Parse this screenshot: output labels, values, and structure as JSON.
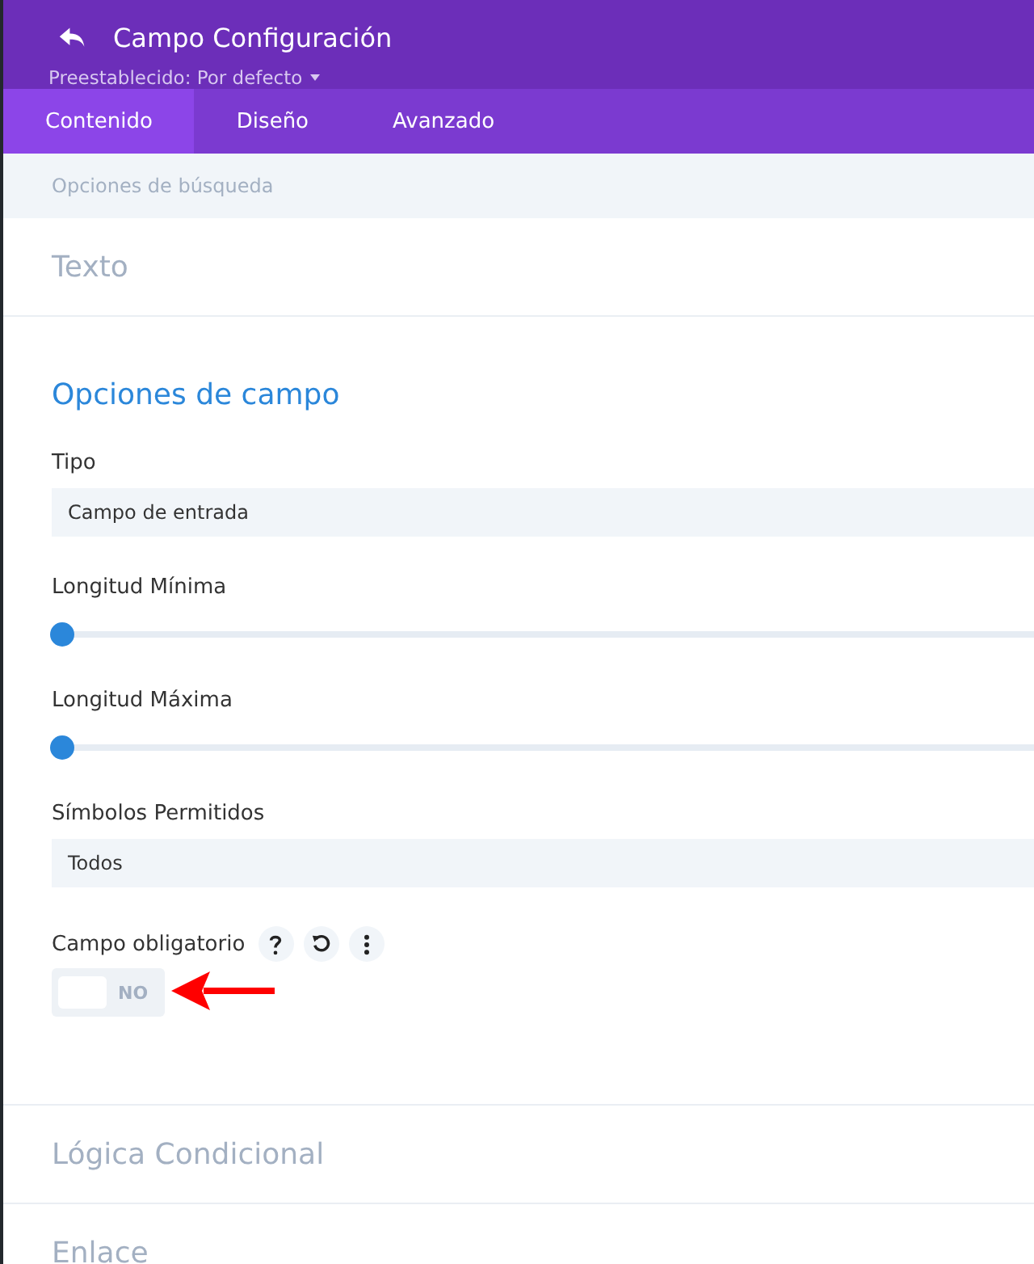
{
  "header": {
    "title": "Campo Configuración",
    "preset": "Preestablecido: Por defecto"
  },
  "tabs": [
    {
      "label": "Contenido",
      "selected": true
    },
    {
      "label": "Diseño",
      "selected": false
    },
    {
      "label": "Avanzado",
      "selected": false
    }
  ],
  "breadcrumb": "Opciones de búsqueda",
  "sections_before": [
    {
      "title": "Texto",
      "expanded": false
    }
  ],
  "open_section": {
    "title": "Opciones de campo",
    "fields": [
      {
        "kind": "select",
        "label": "Tipo",
        "value": "Campo de entrada"
      },
      {
        "kind": "slider",
        "label": "Longitud Mínima",
        "level": 0
      },
      {
        "kind": "slider",
        "label": "Longitud Máxima",
        "level": 0
      },
      {
        "kind": "select",
        "label": "Símbolos Permitidos",
        "value": "Todos"
      },
      {
        "kind": "toggle",
        "label": "Campo obligatorio",
        "on": false,
        "state_text": "NO"
      }
    ]
  },
  "sections_after": [
    {
      "title": "Lógica Condicional"
    },
    {
      "title": "Enlace"
    }
  ]
}
